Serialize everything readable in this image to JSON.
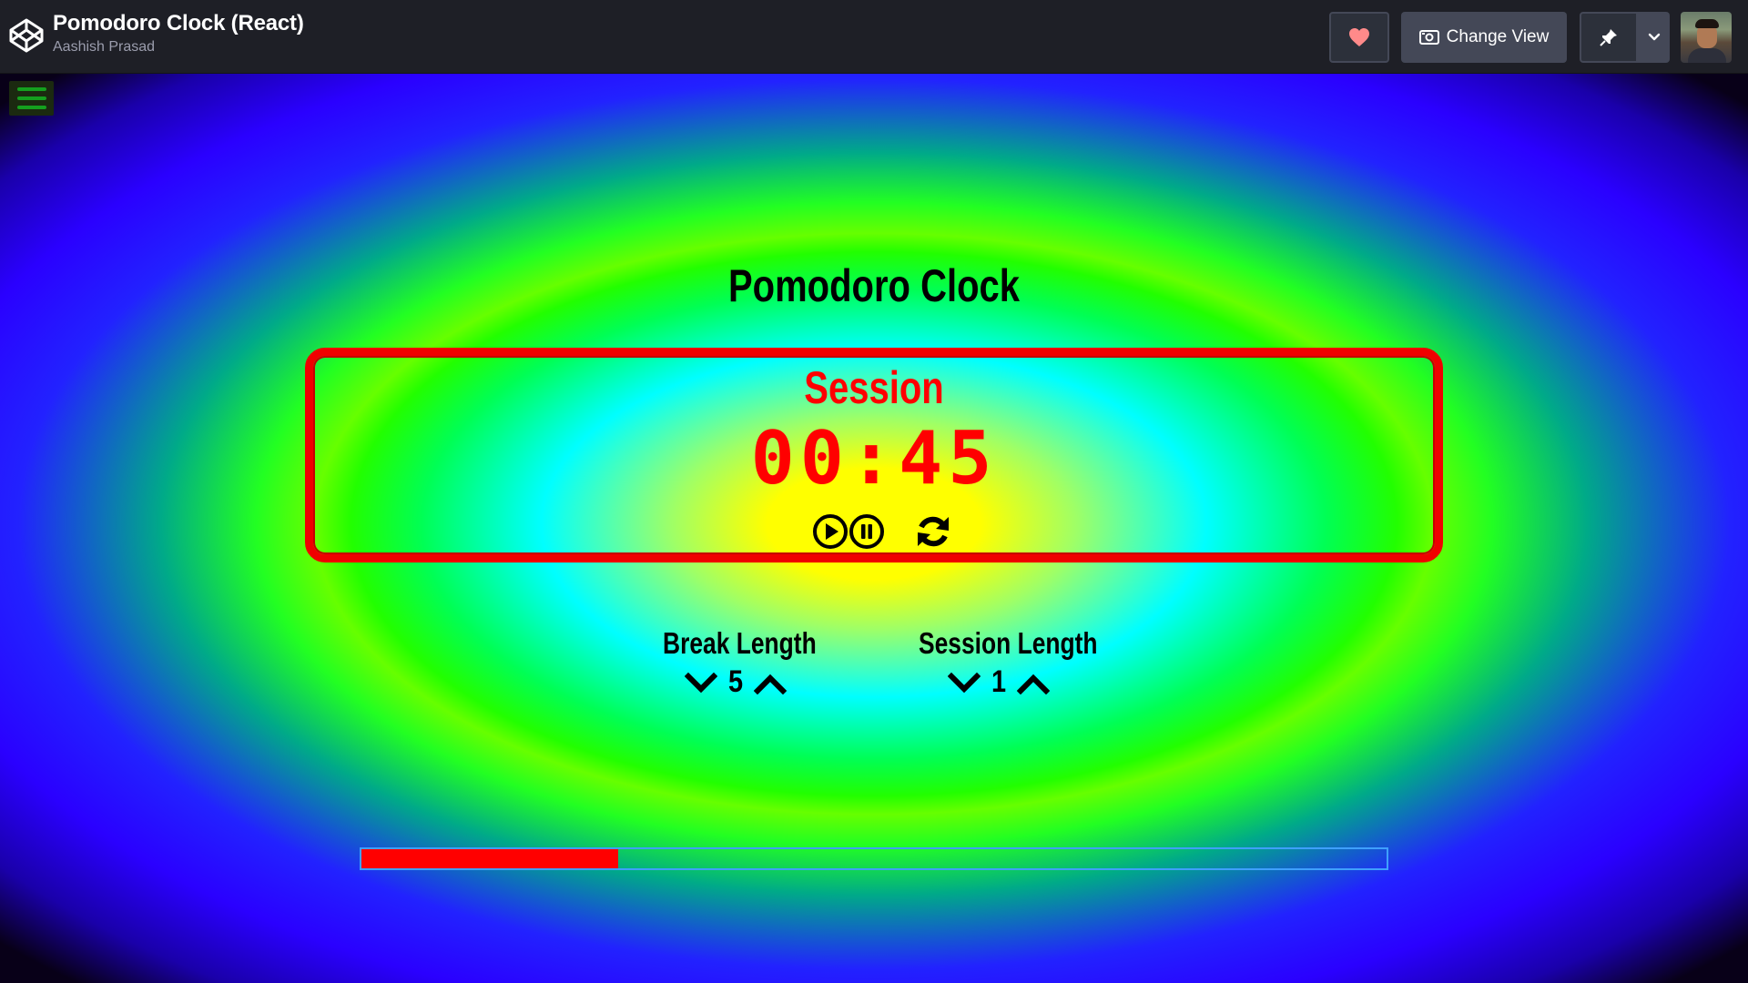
{
  "header": {
    "pen_title": "Pomodoro Clock (React)",
    "author": "Aashish Prasad",
    "change_view_label": "Change View",
    "icons": [
      "codepen-logo-icon",
      "heart-icon",
      "eye-icon",
      "pin-icon",
      "chevron-down-icon"
    ],
    "colors": {
      "background": "#1e1f26",
      "button": "#444857",
      "heart": "#ff6b6b"
    }
  },
  "app": {
    "title": "Pomodoro Clock",
    "mode_label": "Session",
    "time_display": "00:45",
    "break_label": "Break Length",
    "break_value": "5",
    "session_label": "Session Length",
    "session_value": "1",
    "progress_fraction": 0.25,
    "colors": {
      "timer": "#ff0000",
      "progress_fill": "#ff0000",
      "progress_border": "#3fa0ff"
    }
  }
}
